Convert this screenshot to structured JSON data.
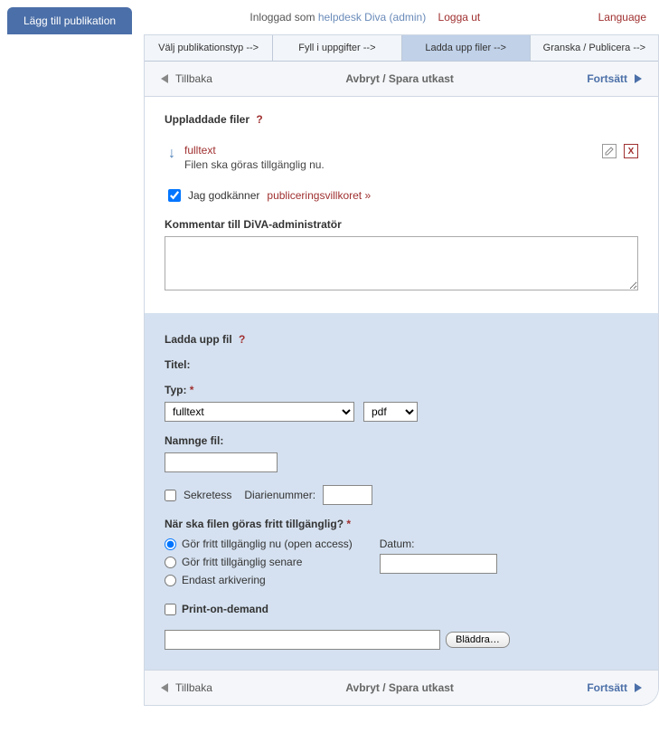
{
  "top": {
    "addTab": "Lägg till publikation",
    "loggedInPrefix": "Inloggad som",
    "user": "helpdesk Diva (admin)",
    "logout": "Logga ut",
    "language": "Language"
  },
  "steps": [
    "Välj publikationstyp -->",
    "Fyll i uppgifter -->",
    "Ladda upp filer -->",
    "Granska / Publicera -->"
  ],
  "nav": {
    "back": "Tillbaka",
    "center": "Avbryt / Spara utkast",
    "forward": "Fortsätt"
  },
  "uploaded": {
    "title": "Uppladdade filer",
    "help": "?",
    "fileName": "fulltext",
    "fileDesc": "Filen ska göras tillgänglig nu.",
    "acceptPrefix": "Jag godkänner",
    "pubLink": "publiceringsvillkoret »",
    "commentLabel": "Kommentar till DiVA-administratör"
  },
  "upload": {
    "title": "Ladda upp fil",
    "help": "?",
    "titleLabel": "Titel:",
    "typeLabel": "Typ:",
    "typeValue": "fulltext",
    "extValue": "pdf",
    "nameLabel": "Namnge fil:",
    "sekretess": "Sekretess",
    "diarieLabel": "Diarienummer:",
    "availLabel": "När ska filen göras fritt tillgänglig?",
    "radios": [
      "Gör fritt tillgänglig nu (open access)",
      "Gör fritt tillgänglig senare",
      "Endast arkivering"
    ],
    "dateLabel": "Datum:",
    "pod": "Print-on-demand",
    "browse": "Bläddra…"
  }
}
